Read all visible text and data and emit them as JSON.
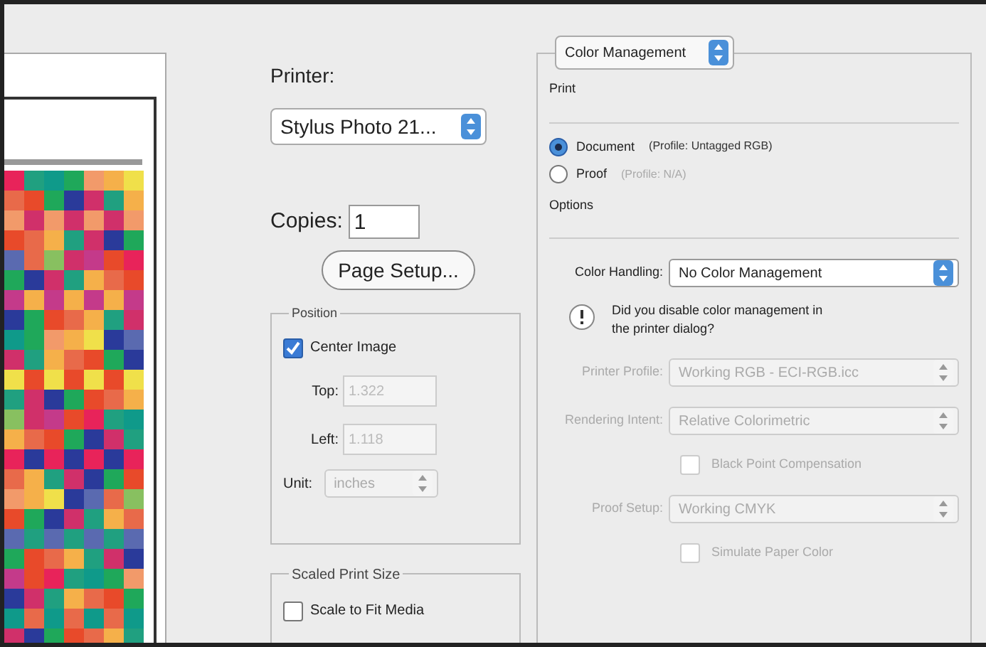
{
  "printer": {
    "label": "Printer:",
    "value": "Stylus Photo 21..."
  },
  "copies": {
    "label": "Copies:",
    "value": "1"
  },
  "page_setup_button": "Page Setup...",
  "position": {
    "title": "Position",
    "center_image": {
      "label": "Center Image",
      "checked": true
    },
    "fields": [
      {
        "label": "Top:",
        "value": "1.322",
        "disabled": true
      },
      {
        "label": "Left:",
        "value": "1.118",
        "disabled": true
      }
    ],
    "unit": {
      "label": "Unit:",
      "value": "inches",
      "disabled": true
    }
  },
  "scaled_print_size": {
    "title": "Scaled Print Size",
    "scale_to_fit": {
      "label": "Scale to Fit Media",
      "checked": false
    }
  },
  "panel_menu": "Color Management",
  "print_section": {
    "label": "Print",
    "options": [
      {
        "label": "Document",
        "profile": "(Profile: Untagged RGB)",
        "selected": true
      },
      {
        "label": "Proof",
        "profile": "(Profile: N/A)",
        "selected": false
      }
    ]
  },
  "options": {
    "label": "Options",
    "color_handling": {
      "label": "Color Handling:",
      "value": "No Color Management"
    },
    "warning": "Did you disable color management in the printer dialog?",
    "rows": [
      {
        "kind": "select",
        "label": "Printer Profile:",
        "value": "Working RGB - ECI-RGB.icc",
        "disabled": true
      },
      {
        "kind": "select",
        "label": "Rendering Intent:",
        "value": "Relative Colorimetric",
        "disabled": true
      },
      {
        "kind": "checkbox",
        "label": "Black Point Compensation",
        "checked": false,
        "disabled": true
      },
      {
        "kind": "select",
        "label": "Proof Setup:",
        "value": "Working CMYK",
        "disabled": true
      },
      {
        "kind": "checkbox",
        "label": "Simulate Paper Color",
        "checked": false,
        "disabled": true
      }
    ]
  }
}
